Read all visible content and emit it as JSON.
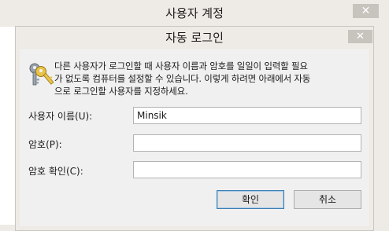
{
  "outer_window": {
    "title": "사용자 계정",
    "close_glyph": "✕"
  },
  "dialog": {
    "title": "자동 로그인",
    "close_glyph": "✕",
    "description": "다른 사용자가 로그인할 때 사용자 이름과 암호를 일일이 입력할 필요\n가 없도록 컴퓨터를 설정할 수 있습니다. 이렇게 하려면 아래에서 자동\n으로 로그인할 사용자를 지정하세요.",
    "icon": "keys-icon",
    "fields": {
      "username": {
        "label": "사용자 이름(U):",
        "value": "Minsik"
      },
      "password": {
        "label": "암호(P):",
        "value": ""
      },
      "confirm": {
        "label": "암호 확인(C):",
        "value": ""
      }
    },
    "buttons": {
      "ok": "확인",
      "cancel": "취소"
    }
  },
  "colors": {
    "chrome": "#eeeae5",
    "close_button": "#c7c3bd",
    "default_button_border": "#3c7fb1"
  }
}
